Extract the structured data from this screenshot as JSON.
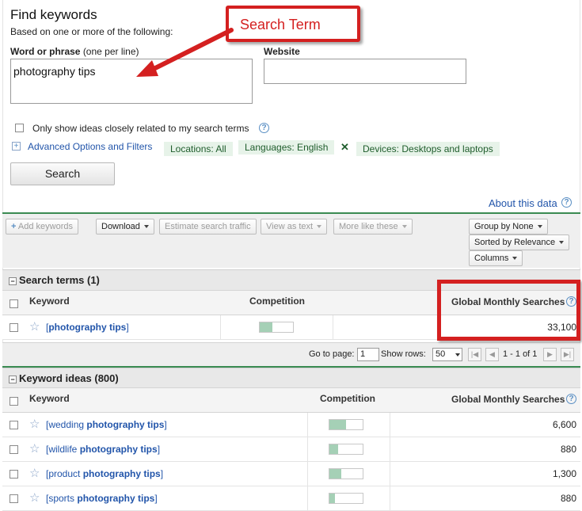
{
  "header": {
    "title": "Find keywords",
    "subtitle": "Based on one or more of the following:",
    "word_label_bold": "Word or phrase",
    "word_label_note": "(one per line)",
    "word_value": "photography tips",
    "website_label": "Website",
    "website_value": ""
  },
  "options": {
    "closely_related_label": "Only show ideas closely related to my search terms",
    "advanced_label": "Advanced Options and Filters",
    "chips": [
      "Locations: All",
      "Languages: English",
      "Devices: Desktops and laptops"
    ]
  },
  "search_button": "Search",
  "about_link": "About this data",
  "toolbar": {
    "add_keywords": "Add keywords",
    "download": "Download",
    "estimate": "Estimate search traffic",
    "view_text": "View as text",
    "more_like": "More like these",
    "group_by": "Group by None",
    "sorted_by": "Sorted by Relevance",
    "columns": "Columns"
  },
  "search_terms": {
    "title": "Search terms (1)",
    "headers": {
      "keyword": "Keyword",
      "competition": "Competition",
      "searches": "Global Monthly Searches"
    },
    "rows": [
      {
        "pre": "[",
        "bold": "photography tips",
        "post": "]",
        "competition": 0.38,
        "searches": "33,100"
      }
    ]
  },
  "pager": {
    "go_to_label": "Go to page:",
    "page_value": "1",
    "show_rows_label": "Show rows:",
    "rows_value": "50",
    "range_text": "1 - 1 of 1"
  },
  "keyword_ideas": {
    "title": "Keyword ideas (800)",
    "headers": {
      "keyword": "Keyword",
      "competition": "Competition",
      "searches": "Global Monthly Searches"
    },
    "rows": [
      {
        "pre": "[wedding ",
        "bold": "photography tips",
        "post": "]",
        "competition": 0.5,
        "searches": "6,600"
      },
      {
        "pre": "[wildlife ",
        "bold": "photography tips",
        "post": "]",
        "competition": 0.27,
        "searches": "880"
      },
      {
        "pre": "[product ",
        "bold": "photography tips",
        "post": "]",
        "competition": 0.36,
        "searches": "1,300"
      },
      {
        "pre": "[sports ",
        "bold": "photography tips",
        "post": "]",
        "competition": 0.16,
        "searches": "880"
      }
    ]
  },
  "annotation": {
    "callout_text": "Search Term",
    "highlight_color": "#d42020"
  },
  "colors": {
    "link": "#2255aa",
    "chip_bg": "#e7f3e9",
    "accent_green": "#3a8b52",
    "competition_fill": "#a5d0b6"
  }
}
